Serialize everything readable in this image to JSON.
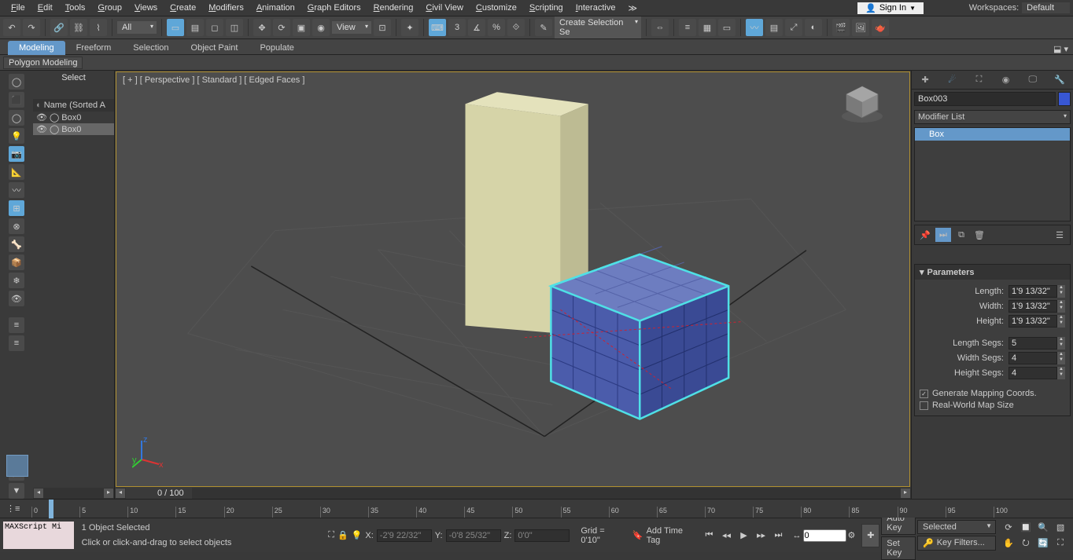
{
  "menubar": {
    "items": [
      "File",
      "Edit",
      "Tools",
      "Group",
      "Views",
      "Create",
      "Modifiers",
      "Animation",
      "Graph Editors",
      "Rendering",
      "Civil View",
      "Customize",
      "Scripting",
      "Interactive"
    ],
    "signin": "Sign In",
    "workspaces_label": "Workspaces:",
    "workspaces_value": "Default"
  },
  "toolbar": {
    "filter_dd": "All",
    "view_dd": "View",
    "selset_dd": "Create Selection Se"
  },
  "ribbon": {
    "tabs": [
      "Modeling",
      "Freeform",
      "Selection",
      "Object Paint",
      "Populate"
    ],
    "active": 0,
    "sub_label": "Polygon Modeling"
  },
  "scene_explorer": {
    "title": "Select",
    "sort_header": "Name (Sorted A",
    "items": [
      {
        "name": "Box0",
        "selected": false
      },
      {
        "name": "Box0",
        "selected": true
      }
    ]
  },
  "viewport": {
    "label": "[ + ] [ Perspective ] [ Standard ] [ Edged Faces ]",
    "frame_label": "0 / 100"
  },
  "command_panel": {
    "object_name": "Box003",
    "modlist_dd": "Modifier List",
    "stack_item": "Box",
    "rollout_title": "Parameters",
    "length_label": "Length:",
    "length_val": "1'9 13/32\"",
    "width_label": "Width:",
    "width_val": "1'9 13/32\"",
    "height_label": "Height:",
    "height_val": "1'9 13/32\"",
    "lsegs_label": "Length Segs:",
    "lsegs_val": "5",
    "wsegs_label": "Width Segs:",
    "wsegs_val": "4",
    "hsegs_label": "Height Segs:",
    "hsegs_val": "4",
    "gen_map": "Generate Mapping Coords.",
    "real_world": "Real-World Map Size"
  },
  "timeline": {
    "ticks": [
      "0",
      "5",
      "10",
      "15",
      "20",
      "25",
      "30",
      "35",
      "40",
      "45",
      "50",
      "55",
      "60",
      "65",
      "70",
      "75",
      "80",
      "85",
      "90",
      "95",
      "100"
    ]
  },
  "status": {
    "script": "MAXScript Mi",
    "sel_msg": "1 Object Selected",
    "prompt": "Click or click-and-drag to select objects",
    "x_label": "X:",
    "x_val": "-2'9 22/32\"",
    "y_label": "Y:",
    "y_val": "-0'8 25/32\"",
    "z_label": "Z:",
    "z_val": "0'0\"",
    "grid": "Grid = 0'10\"",
    "timetag": "Add Time Tag",
    "frame_val": "0",
    "autokey": "Auto Key",
    "setkey": "Set Key",
    "keymode_dd": "Selected",
    "keyfilters": "Key Filters..."
  }
}
